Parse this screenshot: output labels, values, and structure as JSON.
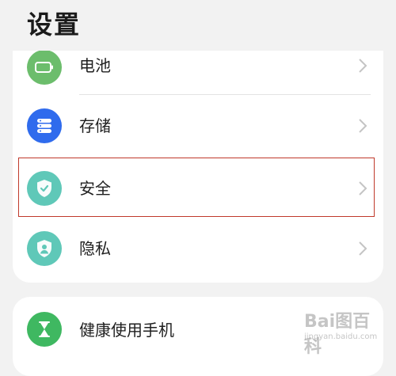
{
  "header": {
    "title": "设置"
  },
  "settings_list": [
    {
      "label": "电池",
      "icon": "battery-icon",
      "color": "#6cbd6c"
    },
    {
      "label": "存储",
      "icon": "storage-icon",
      "color": "#2f6bed"
    },
    {
      "label": "安全",
      "icon": "security-shield-icon",
      "color": "#5fc8b8"
    },
    {
      "label": "隐私",
      "icon": "privacy-shield-icon",
      "color": "#5fc8b8"
    }
  ],
  "second_group": [
    {
      "label": "健康使用手机",
      "icon": "hourglass-icon",
      "color": "#3fb861"
    }
  ],
  "highlight_color": "#c0392b",
  "watermark": {
    "main": "Bai图百科",
    "sub": "jingyan.baidu.com"
  }
}
